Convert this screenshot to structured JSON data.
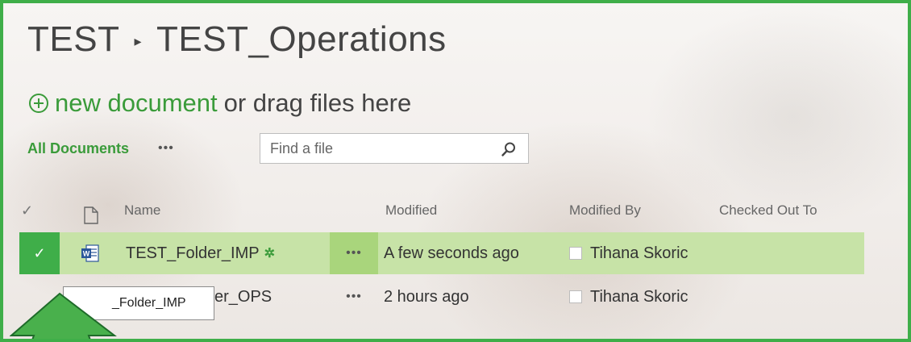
{
  "breadcrumb": {
    "site": "TEST",
    "separator": "▸",
    "library": "TEST_Operations"
  },
  "new_document": {
    "link_text": "new document",
    "rest_text": "or drag files here"
  },
  "view": {
    "name": "All Documents",
    "more": "•••"
  },
  "search": {
    "placeholder": "Find a file"
  },
  "columns": {
    "name": "Name",
    "modified": "Modified",
    "modified_by": "Modified By",
    "checked_out_to": "Checked Out To"
  },
  "rows": [
    {
      "name": "TEST_Folder_IMP",
      "new_badge": "✲",
      "more": "•••",
      "modified": "A few seconds ago",
      "modified_by": "Tihana Skoric",
      "selected": true
    },
    {
      "name": "er_OPS",
      "more": "•••",
      "modified": "2 hours ago",
      "modified_by": "Tihana Skoric",
      "selected": false
    }
  ],
  "tooltip": {
    "text": "_Folder_IMP"
  },
  "colors": {
    "accent": "#3fae49",
    "link": "#3a9b3a",
    "selected_row": "#c7e3a7",
    "selected_more": "#a9d57c"
  }
}
